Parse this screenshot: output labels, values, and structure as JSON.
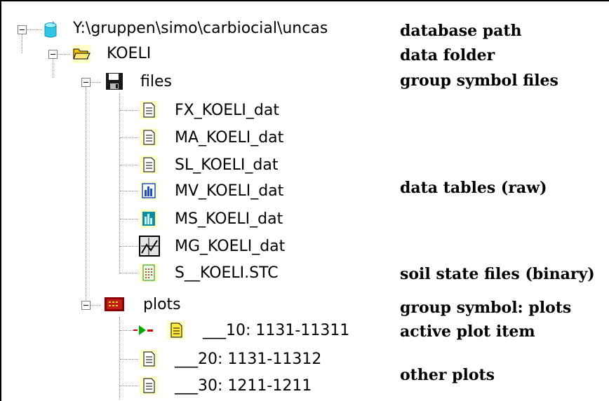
{
  "tree": {
    "root": {
      "label": "Y:\\gruppen\\simo\\carbiocial\\uncas",
      "icon": "database-icon"
    },
    "folder": {
      "label": "KOELI",
      "icon": "folder-open-icon"
    },
    "files_group": {
      "label": "files",
      "icon": "floppy-disk-icon"
    },
    "files": [
      {
        "label": "FX_KOELI_dat",
        "icon": "document-icon"
      },
      {
        "label": "MA_KOELI_dat",
        "icon": "document-icon"
      },
      {
        "label": "SL_KOELI_dat",
        "icon": "document-icon"
      },
      {
        "label": "MV_KOELI_dat",
        "icon": "bar-chart-blue-icon"
      },
      {
        "label": "MS_KOELI_dat",
        "icon": "bar-chart-teal-icon"
      },
      {
        "label": "MG_KOELI_dat",
        "icon": "graph-curve-icon"
      },
      {
        "label": "S__KOELI.STC",
        "icon": "grid-document-green-icon"
      }
    ],
    "plots_group": {
      "label": "plots",
      "icon": "plots-group-icon"
    },
    "plots": [
      {
        "label": "___10: 1131-11311",
        "icon": "document-yellow-icon",
        "active": true
      },
      {
        "label": "___20: 1131-11312",
        "icon": "document-icon",
        "active": false
      },
      {
        "label": "___30: 1211-1211",
        "icon": "document-icon",
        "active": false
      }
    ]
  },
  "annotations": {
    "database_path": "database path",
    "data_folder": "data folder",
    "group_symbol_files": "group symbol files",
    "data_tables_raw": "data tables (raw)",
    "soil_state_files": "soil state files (binary)",
    "group_symbol_plots": "group symbol: plots",
    "active_plot_item": "active plot item",
    "other_plots": "other plots"
  },
  "colors": {
    "tree_line": "#888888",
    "icon_highlight": "#ffffc8",
    "active_marker": "#cc0000",
    "active_arrow": "#00aa00"
  }
}
